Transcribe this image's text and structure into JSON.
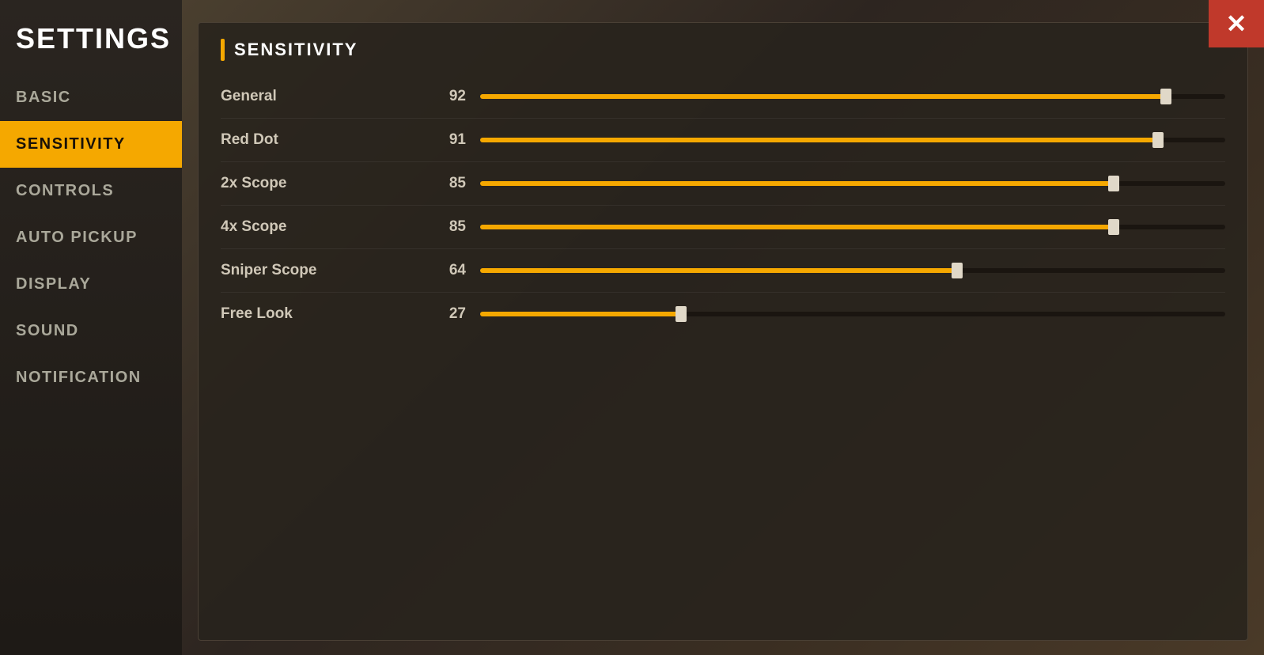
{
  "sidebar": {
    "title": "SETTINGS",
    "items": [
      {
        "id": "basic",
        "label": "BASIC",
        "active": false
      },
      {
        "id": "sensitivity",
        "label": "SENSITIVITY",
        "active": true
      },
      {
        "id": "controls",
        "label": "CONTROLS",
        "active": false
      },
      {
        "id": "auto-pickup",
        "label": "AUTO PICKUP",
        "active": false
      },
      {
        "id": "display",
        "label": "DISPLAY",
        "active": false
      },
      {
        "id": "sound",
        "label": "SOUND",
        "active": false
      },
      {
        "id": "notification",
        "label": "NOTIFICATION",
        "active": false
      }
    ]
  },
  "close_button_label": "✕",
  "panel": {
    "title": "SENSITIVITY",
    "sliders": [
      {
        "id": "general",
        "label": "General",
        "value": 92,
        "percent": 92
      },
      {
        "id": "red-dot",
        "label": "Red Dot",
        "value": 91,
        "percent": 91
      },
      {
        "id": "2x-scope",
        "label": "2x Scope",
        "value": 85,
        "percent": 85
      },
      {
        "id": "4x-scope",
        "label": "4x Scope",
        "value": 85,
        "percent": 85
      },
      {
        "id": "sniper-scope",
        "label": "Sniper Scope",
        "value": 64,
        "percent": 64
      },
      {
        "id": "free-look",
        "label": "Free Look",
        "value": 27,
        "percent": 27
      }
    ]
  },
  "colors": {
    "accent": "#f5a800",
    "close_bg": "#c0392b"
  }
}
